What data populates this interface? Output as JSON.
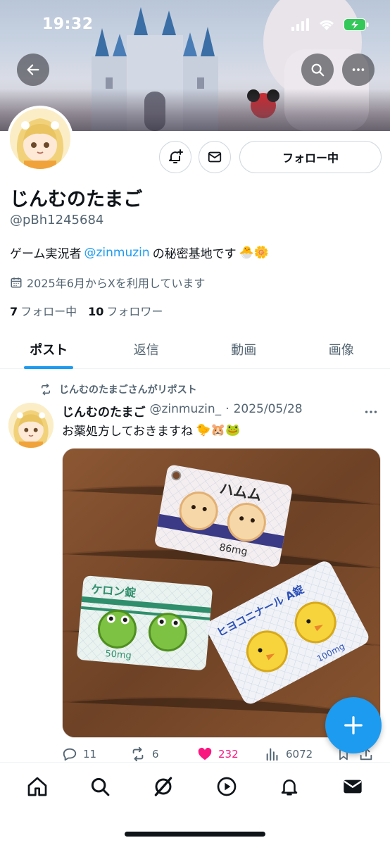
{
  "status_bar": {
    "time": "19:32"
  },
  "profile": {
    "follow_button_label": "フォロー中",
    "display_name": "じんむのたまご",
    "handle": "@pBh1245684",
    "bio_prefix": "ゲーム実況者",
    "bio_mention": "@zinmuzin",
    "bio_suffix": "の秘密基地です",
    "bio_emoji": "🐣🌼",
    "joined": "2025年6月からXを利用しています",
    "following_count": "7",
    "following_label": "フォロー中",
    "followers_count": "10",
    "followers_label": "フォロワー"
  },
  "tabs": [
    {
      "label": "ポスト",
      "active": true
    },
    {
      "label": "返信",
      "active": false
    },
    {
      "label": "動画",
      "active": false
    },
    {
      "label": "画像",
      "active": false
    }
  ],
  "post": {
    "repost_label": "じんむのたまごさんがリポスト",
    "author_name": "じんむのたまご",
    "author_handle": "@zinmuzin_",
    "date": "2025/05/28",
    "text": "お薬処方しておきますね",
    "text_emoji": "🐤🐹🐸",
    "image_texts": {
      "ham": "ハムム",
      "ham_dose": "86mg",
      "kero": "ケロン錠",
      "kero_dose": "50mg",
      "hiyoko": "ヒヨコニナール A錠",
      "hiyoko_dose": "100mg"
    },
    "replies": "11",
    "reposts": "6",
    "likes": "232",
    "views": "6072"
  },
  "colors": {
    "accent": "#1d9bf0",
    "like": "#f91880",
    "text": "#0f1419",
    "muted": "#536471"
  },
  "icons": [
    "back-icon",
    "search-icon",
    "more-icon",
    "notify-plus-icon",
    "mail-icon",
    "calendar-icon",
    "repost-icon",
    "reply-icon",
    "like-icon",
    "views-icon",
    "bookmark-icon",
    "share-icon",
    "plus-icon",
    "home-icon",
    "grok-icon",
    "play-icon",
    "bell-icon",
    "messages-icon"
  ]
}
